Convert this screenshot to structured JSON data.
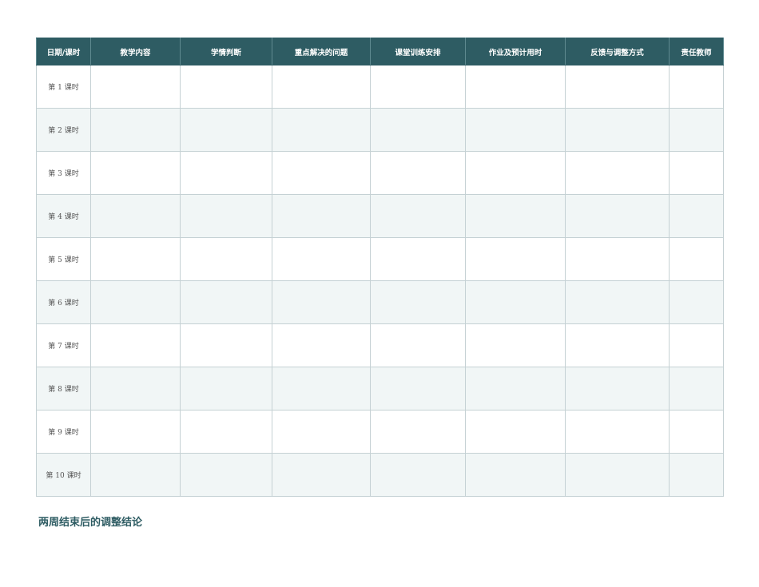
{
  "table": {
    "headers": [
      "日期/课时",
      "教学内容",
      "学情判断",
      "重点解决的问题",
      "课堂训练安排",
      "作业及预计用时",
      "反馈与调整方式",
      "责任教师"
    ],
    "rows": [
      {
        "session": "第 1 课时"
      },
      {
        "session": "第 2 课时"
      },
      {
        "session": "第 3 课时"
      },
      {
        "session": "第 4 课时"
      },
      {
        "session": "第 5 课时"
      },
      {
        "session": "第 6 课时"
      },
      {
        "session": "第 7 课时"
      },
      {
        "session": "第 8 课时"
      },
      {
        "session": "第 9 课时"
      },
      {
        "session": "第 10 课时"
      }
    ]
  },
  "conclusion": {
    "heading": "两周结束后的调整结论"
  },
  "colors": {
    "header_bg": "#2e5c63",
    "header_text": "#ffffff",
    "row_alt_bg": "#f1f6f6",
    "border": "#c5d1d4",
    "heading_text": "#2e5c63"
  }
}
